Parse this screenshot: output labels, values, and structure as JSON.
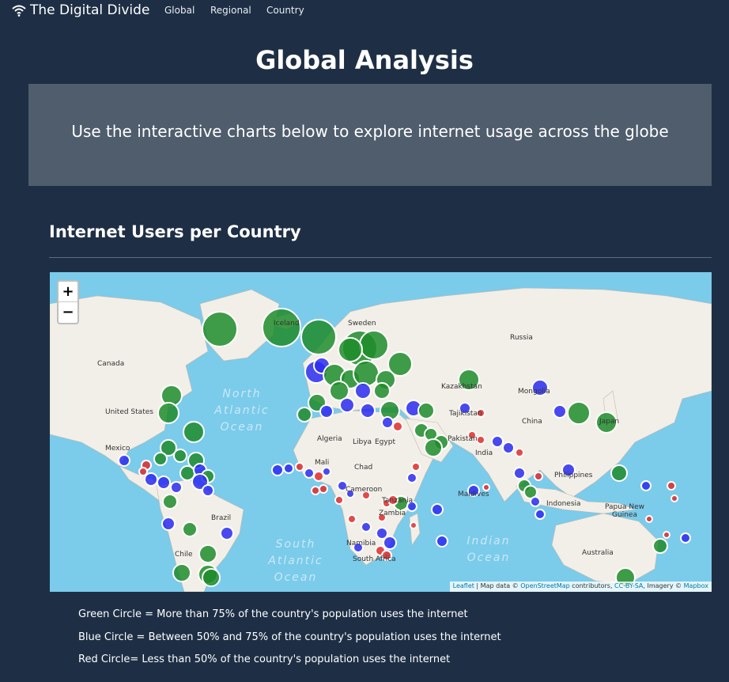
{
  "navbar": {
    "brand": "The Digital Divide",
    "links": [
      "Global",
      "Regional",
      "Country"
    ]
  },
  "page_title": "Global Analysis",
  "hero_text": "Use the interactive charts below to explore internet usage across the globe",
  "section_title": "Internet Users per Country",
  "map": {
    "zoom_in": "+",
    "zoom_out": "−",
    "ocean_labels": {
      "north_atlantic": "North\nAtlantic\nOcean",
      "south_atlantic": "South\nAtlantic\nOcean",
      "indian": "Indian\nOcean"
    },
    "place_labels": [
      "Iceland",
      "Sweden",
      "Russia",
      "Canada",
      "United States",
      "Kazakhstan",
      "Mongolia",
      "China",
      "Japan",
      "Tajikistan",
      "Pakistan",
      "India",
      "Algeria",
      "Libya",
      "Egypt",
      "Mali",
      "Chad",
      "Mexico",
      "Cameroon",
      "Tanzania",
      "Zambia",
      "Namibia",
      "South Africa",
      "Brazil",
      "Chile",
      "Maldives",
      "Philippines",
      "Indonesia",
      "Papua New Guinea",
      "Australia"
    ],
    "attribution": {
      "leaflet": "Leaflet",
      "sep1": " | Map data © ",
      "osm": "OpenStreetMap",
      "contrib": " contributors, ",
      "license": "CC-BY-SA",
      "imagery": ", Imagery © ",
      "mapbox": "Mapbox"
    }
  },
  "legend": {
    "green": "Green Circle = More than 75% of the country's population uses the internet",
    "blue": "Blue Circle = Between 50% and 75% of the country's population uses the internet",
    "red": "Red Circle= Less than 50% of the country's population uses the internet"
  },
  "colors": {
    "background": "#1e2f45",
    "hero": "#4f5d6d",
    "ocean": "#7bcbeb",
    "land": "#f2efe8",
    "green_circle": "#1f8c2a",
    "blue_circle": "#2b2bf0",
    "red_circle": "#e02b2b"
  }
}
